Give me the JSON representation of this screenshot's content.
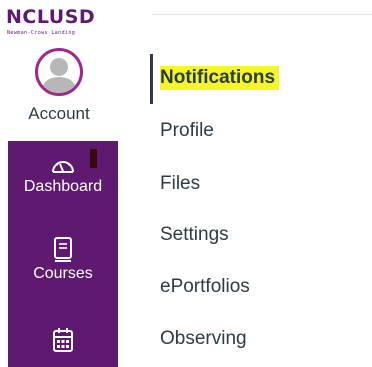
{
  "logo": {
    "title": "NCLUSD",
    "subtitle": "Newman-Crows Landing"
  },
  "account": {
    "label": "Account",
    "icon": "user-avatar-icon"
  },
  "nav": [
    {
      "label": "Dashboard",
      "icon": "speedometer-icon"
    },
    {
      "label": "Courses",
      "icon": "book-icon"
    },
    {
      "label": "",
      "icon": "calendar-icon"
    }
  ],
  "menu": [
    {
      "label": "Notifications",
      "active": true
    },
    {
      "label": "Profile"
    },
    {
      "label": "Files"
    },
    {
      "label": "Settings"
    },
    {
      "label": "ePortfolios"
    },
    {
      "label": "Observing"
    }
  ],
  "colors": {
    "brand": "#5e1a6e",
    "highlight": "#f5f52a",
    "text": "#2d3b45",
    "avatar_ring": "#9c2a8c"
  }
}
